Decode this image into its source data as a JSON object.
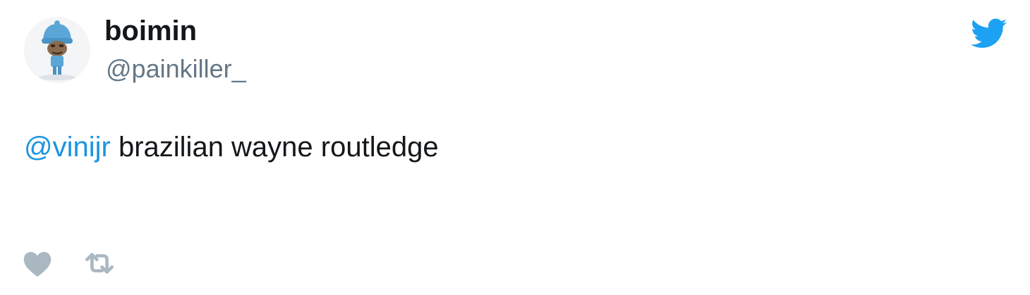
{
  "user": {
    "display_name": "boimin",
    "handle": "@painkiller_",
    "avatar_icon": "pocoyo-avatar-icon"
  },
  "tweet": {
    "mention": "@vinijr",
    "text": "brazilian wayne routledge"
  },
  "actions": {
    "like_icon": "heart-icon",
    "retweet_icon": "retweet-icon"
  },
  "brand": {
    "logo": "twitter-bird-icon",
    "accent_color": "#1b95e0",
    "handle_color": "#657786",
    "icon_color": "#aab8c2"
  }
}
